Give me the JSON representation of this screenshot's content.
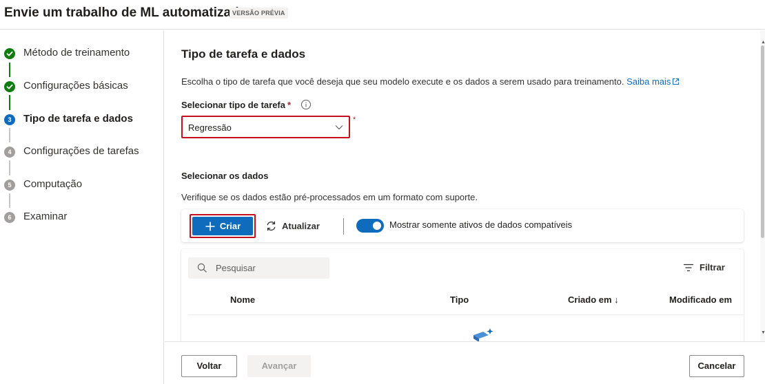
{
  "header": {
    "title": "Envie um trabalho de ML automatizado",
    "badge": "VERSÃO PRÉVIA"
  },
  "stepper": {
    "steps": [
      {
        "label": "Método de treinamento",
        "state": "done",
        "number": "1"
      },
      {
        "label": "Configurações básicas",
        "state": "done",
        "number": "2"
      },
      {
        "label": "Tipo de tarefa e dados",
        "state": "current",
        "number": "3"
      },
      {
        "label": "Configurações de tarefas",
        "state": "pending",
        "number": "4"
      },
      {
        "label": "Computação",
        "state": "pending",
        "number": "5"
      },
      {
        "label": "Examinar",
        "state": "pending",
        "number": "6"
      }
    ]
  },
  "main": {
    "title": "Tipo de tarefa e dados",
    "description": "Escolha o tipo de tarefa que você deseja que seu modelo execute e os dados a serem usado para treinamento.",
    "learn_more": "Saiba mais",
    "task_type_label": "Selecionar tipo de tarefa",
    "required_mark": "*",
    "task_type_value": "Regressão",
    "data_title": "Selecionar os dados",
    "data_description": "Verifique se os dados estão pré-processados em um formato com suporte."
  },
  "toolbar": {
    "create_label": "Criar",
    "refresh_label": "Atualizar",
    "toggle_label": "Mostrar somente ativos de dados compatíveis",
    "toggle_on": true
  },
  "table": {
    "search_placeholder": "Pesquisar",
    "filter_label": "Filtrar",
    "columns": [
      "Nome",
      "Tipo",
      "Criado em ↓",
      "Modificado em"
    ]
  },
  "footer": {
    "back_label": "Voltar",
    "next_label": "Avançar",
    "cancel_label": "Cancelar"
  },
  "colors": {
    "accent": "#0f6cbd",
    "done": "#107c10",
    "highlight": "#c50f1f"
  }
}
